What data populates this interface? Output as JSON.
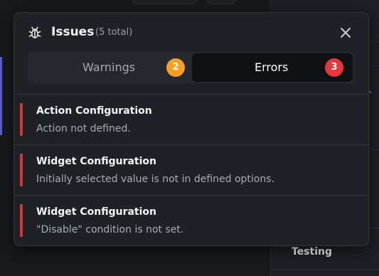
{
  "background": {
    "bottom_label": "Testing"
  },
  "issues_panel": {
    "title": "Issues",
    "total": "(5 total)",
    "icons": {
      "header": "bug-icon",
      "close": "close-icon"
    },
    "tabs": [
      {
        "label": "Warnings",
        "count": "2",
        "color": "#f59f27",
        "selected": false
      },
      {
        "label": "Errors",
        "count": "3",
        "color": "#e5373c",
        "selected": true
      }
    ],
    "items": [
      {
        "title": "Action Configuration",
        "description": "Action not defined."
      },
      {
        "title": "Widget Configuration",
        "description": "Initially selected value is not in defined options."
      },
      {
        "title": "Widget Configuration",
        "description": "\"Disable\" condition is not set."
      }
    ]
  }
}
